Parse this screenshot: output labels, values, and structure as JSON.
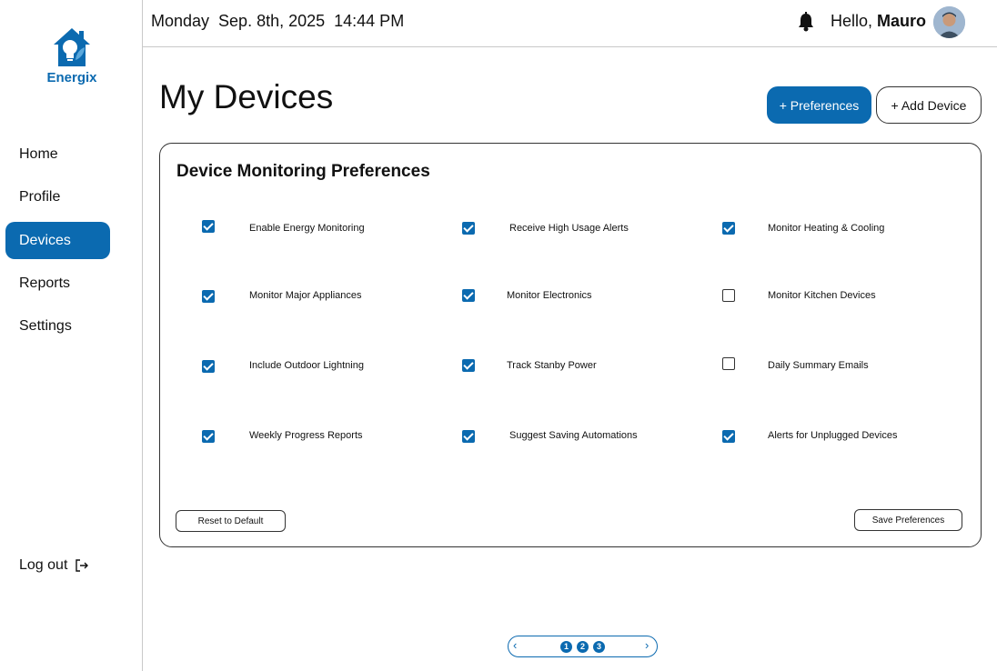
{
  "app": {
    "name": "Energix"
  },
  "topbar": {
    "datetime": "Monday  Sep. 8th, 2025  14:44 PM",
    "greeting_prefix": "Hello, ",
    "user_name": "Mauro",
    "bell_icon": "bell-icon"
  },
  "sidebar": {
    "items": [
      {
        "label": "Home",
        "active": false
      },
      {
        "label": "Profile",
        "active": false
      },
      {
        "label": "Devices",
        "active": true
      },
      {
        "label": "Reports",
        "active": false
      },
      {
        "label": "Settings",
        "active": false
      }
    ],
    "logout_label": "Log out"
  },
  "header": {
    "title": "My Devices",
    "preferences_label": "+ Preferences",
    "add_device_label": "+ Add Device"
  },
  "card": {
    "title": "Device Monitoring Preferences",
    "options": [
      {
        "label": "Enable Energy Monitoring",
        "checked": true
      },
      {
        "label": "Receive High Usage Alerts",
        "checked": true
      },
      {
        "label": "Monitor Heating & Cooling",
        "checked": true
      },
      {
        "label": "Monitor Major Appliances",
        "checked": true
      },
      {
        "label": "Monitor Electronics",
        "checked": true
      },
      {
        "label": "Monitor Kitchen Devices",
        "checked": false
      },
      {
        "label": "Include Outdoor Lightning",
        "checked": true
      },
      {
        "label": "Track Stanby Power",
        "checked": true
      },
      {
        "label": "Daily Summary Emails",
        "checked": false
      },
      {
        "label": "Weekly Progress Reports",
        "checked": true
      },
      {
        "label": "Suggest Saving Automations",
        "checked": true
      },
      {
        "label": "Alerts for Unplugged Devices",
        "checked": true
      }
    ],
    "reset_label": "Reset to Default",
    "save_label": "Save Preferences"
  },
  "pagination": {
    "prev": "‹",
    "next": "›",
    "pages": [
      "1",
      "2",
      "3"
    ]
  },
  "colors": {
    "accent": "#0b6ab0"
  }
}
